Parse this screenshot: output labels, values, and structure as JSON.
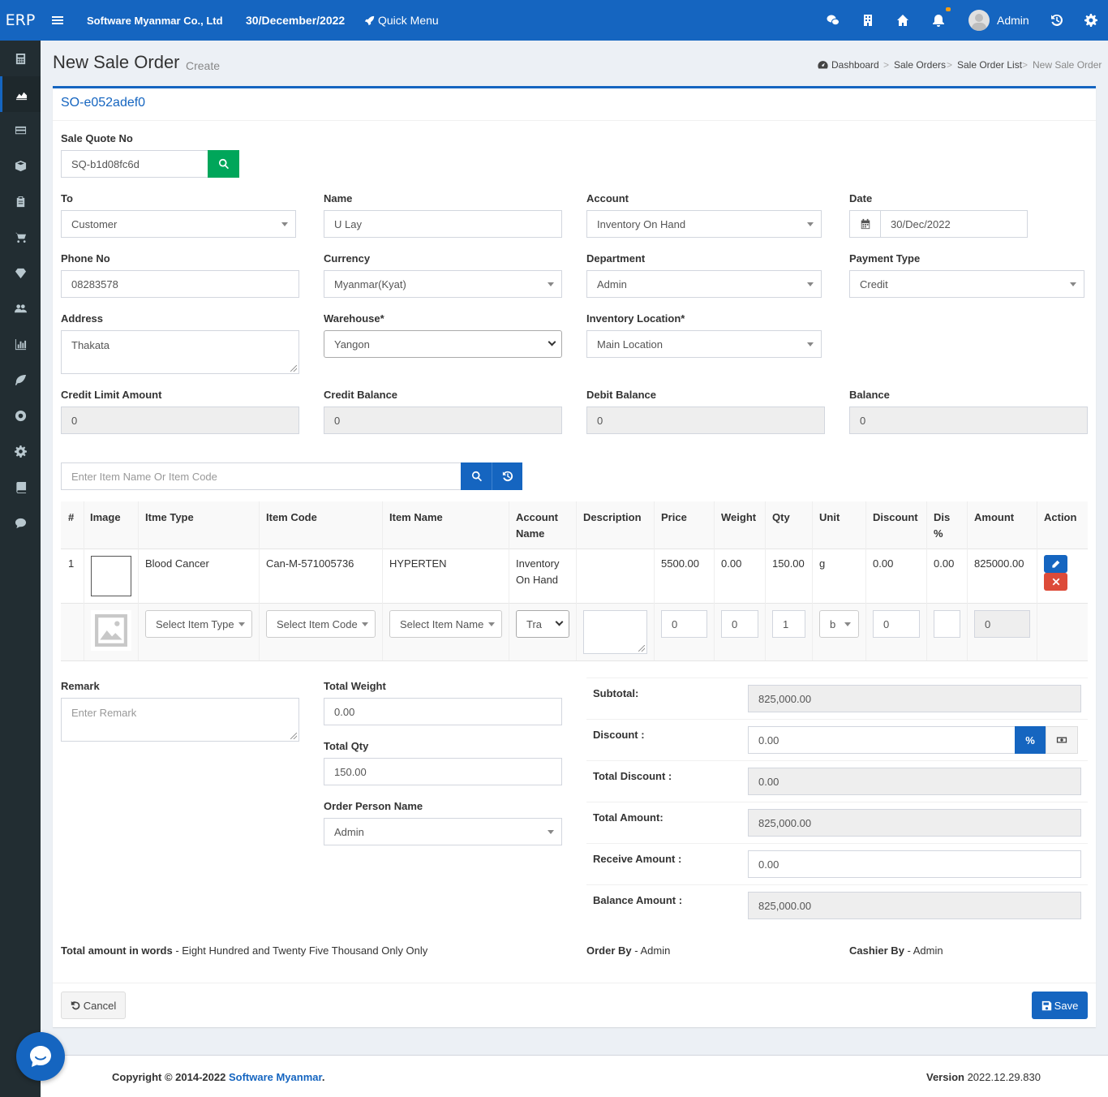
{
  "header": {
    "logo": "ERP",
    "company": "Software Myanmar Co., Ltd",
    "date": "30/December/2022",
    "quick_menu": "Quick Menu",
    "user": "Admin"
  },
  "page": {
    "title": "New Sale Order",
    "subtitle": "Create",
    "breadcrumb": [
      "Dashboard",
      "Sale Orders",
      "Sale Order List",
      "New Sale Order"
    ]
  },
  "form": {
    "order_no": "SO-e052adef0",
    "sale_quote_label": "Sale Quote No",
    "sale_quote_value": "SQ-b1d08fc6d",
    "to_label": "To",
    "to_value": "Customer",
    "name_label": "Name",
    "name_value": "U Lay",
    "account_label": "Account",
    "account_value": "Inventory On Hand",
    "date_label": "Date",
    "date_value": "30/Dec/2022",
    "phone_label": "Phone No",
    "phone_value": "08283578",
    "currency_label": "Currency",
    "currency_value": "Myanmar(Kyat)",
    "department_label": "Department",
    "department_value": "Admin",
    "payment_label": "Payment Type",
    "payment_value": "Credit",
    "address_label": "Address",
    "address_value": "Thakata",
    "warehouse_label": "Warehouse*",
    "warehouse_value": "Yangon",
    "location_label": "Inventory Location*",
    "location_value": "Main Location",
    "credit_limit_label": "Credit Limit Amount",
    "credit_limit_value": "0",
    "credit_balance_label": "Credit Balance",
    "credit_balance_value": "0",
    "debit_balance_label": "Debit Balance",
    "debit_balance_value": "0",
    "balance_label": "Balance",
    "balance_value": "0",
    "item_search_placeholder": "Enter Item Name Or Item Code"
  },
  "table": {
    "headers": [
      "#",
      "Image",
      "Itme Type",
      "Item Code",
      "Item Name",
      "Account",
      "Name",
      "Description",
      "Price",
      "Weight",
      "Qty",
      "Unit",
      "Discount",
      "Dis",
      "%",
      "Amount",
      "Action"
    ],
    "row": {
      "no": "1",
      "type": "Blood Cancer",
      "code": "Can-M-571005736",
      "name": "HYPERTEN",
      "account_1": "Inventory",
      "account_2": "On Hand",
      "price": "5500.00",
      "weight": "0.00",
      "qty": "150.00",
      "unit": "g",
      "discount": "0.00",
      "dis_pct": "0.00",
      "amount": "825000.00"
    },
    "entry": {
      "type": "Select Item Type",
      "code": "Select Item Code",
      "name": "Select Item Name",
      "account": "Tra",
      "price": "0",
      "weight": "0",
      "qty": "1",
      "unit": "b",
      "discount": "0",
      "amount": "0"
    }
  },
  "bottom": {
    "remark_label": "Remark",
    "remark_placeholder": "Enter Remark",
    "total_weight_label": "Total Weight",
    "total_weight_value": "0.00",
    "total_qty_label": "Total Qty",
    "total_qty_value": "150.00",
    "order_person_label": "Order Person Name",
    "order_person_value": "Admin"
  },
  "summary": {
    "subtotal_label": "Subtotal:",
    "subtotal_value": "825,000.00",
    "discount_label": "Discount :",
    "discount_value": "0.00",
    "discount_pct": "%",
    "total_discount_label": "Total Discount :",
    "total_discount_value": "0.00",
    "total_amount_label": "Total Amount:",
    "total_amount_value": "825,000.00",
    "receive_label": "Receive Amount :",
    "receive_value": "0.00",
    "balance_amount_label": "Balance Amount :",
    "balance_amount_value": "825,000.00"
  },
  "words": {
    "label": "Total amount in words",
    "value": " - Eight Hundred and Twenty Five Thousand Only Only",
    "order_by_label": "Order By",
    "order_by_value": " - Admin",
    "cashier_label": "Cashier By",
    "cashier_value": " - Admin"
  },
  "actions": {
    "cancel": "Cancel",
    "save": "Save"
  },
  "footer": {
    "copyright": "Copyright © 2014-2022 ",
    "brand": "Software Myanmar",
    "dot": ".",
    "version_label": "Version",
    "version_value": " 2022.12.29.830"
  },
  "colors": {
    "primary": "#1565c0",
    "success": "#00a65a",
    "danger": "#dd4b39",
    "sidebar": "#222d32"
  }
}
